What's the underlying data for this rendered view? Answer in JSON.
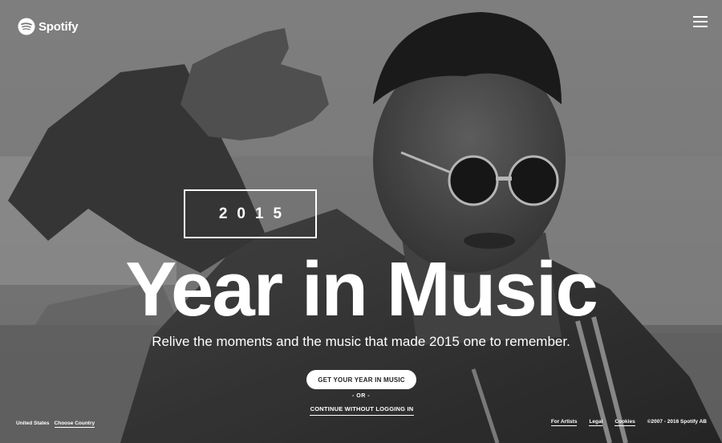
{
  "header": {
    "brand": "Spotify",
    "logo_icon": "spotify-logo-icon",
    "menu_icon": "hamburger-menu-icon"
  },
  "hero": {
    "year": "2015",
    "title": "Year in Music",
    "subtitle": "Relive the moments and the music that made 2015 one to remember.",
    "cta_label": "GET YOUR YEAR IN MUSIC",
    "separator": "- OR -",
    "continue_label": "CONTINUE WITHOUT LOGGING IN"
  },
  "footer": {
    "country": "United States",
    "choose_country": "Choose Country",
    "links": [
      "For Artists",
      "Legal",
      "Cookies"
    ],
    "copyright": "©2007 - 2016 Spotify AB"
  },
  "colors": {
    "text": "#ffffff",
    "button_bg": "#ffffff",
    "button_text": "#222222",
    "background": "#7a7a7a"
  }
}
